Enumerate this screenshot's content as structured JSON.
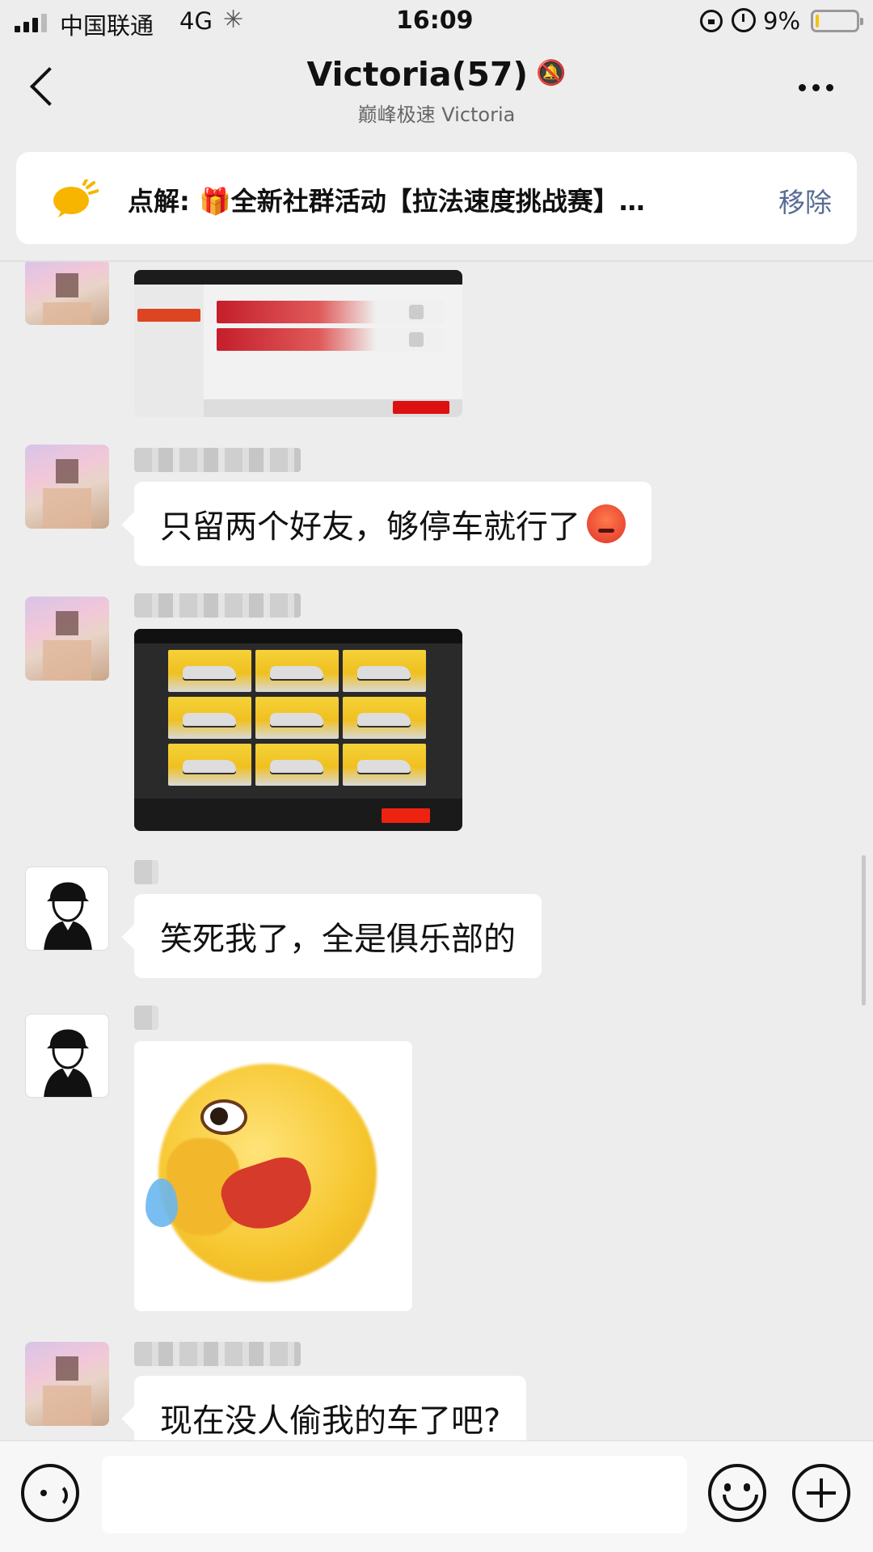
{
  "status_bar": {
    "carrier": "中国联通",
    "network": "4G",
    "time": "16:09",
    "battery_percent": "9%",
    "battery_level": 0.09
  },
  "nav": {
    "title": "Victoria(57)",
    "subtitle": "巅峰极速 Victoria"
  },
  "notice": {
    "text": "点解: 🎁全新社群活动【拉法速度挑战赛】…",
    "remove_label": "移除"
  },
  "messages": [
    {
      "type": "image",
      "image": "game-friends-screenshot"
    },
    {
      "type": "text",
      "text": "只留两个好友，够停车就行了"
    },
    {
      "type": "image",
      "image": "game-garage-screenshot"
    },
    {
      "type": "text",
      "text": "笑死我了，全是俱乐部的"
    },
    {
      "type": "image",
      "image": "crying-face-sticker"
    },
    {
      "type": "text",
      "text": "现在没人偷我的车了吧?"
    }
  ],
  "input": {
    "placeholder": ""
  },
  "colors": {
    "background": "#ededed",
    "bubble": "#ffffff",
    "link": "#576b95",
    "battery": "#f1c40f"
  }
}
